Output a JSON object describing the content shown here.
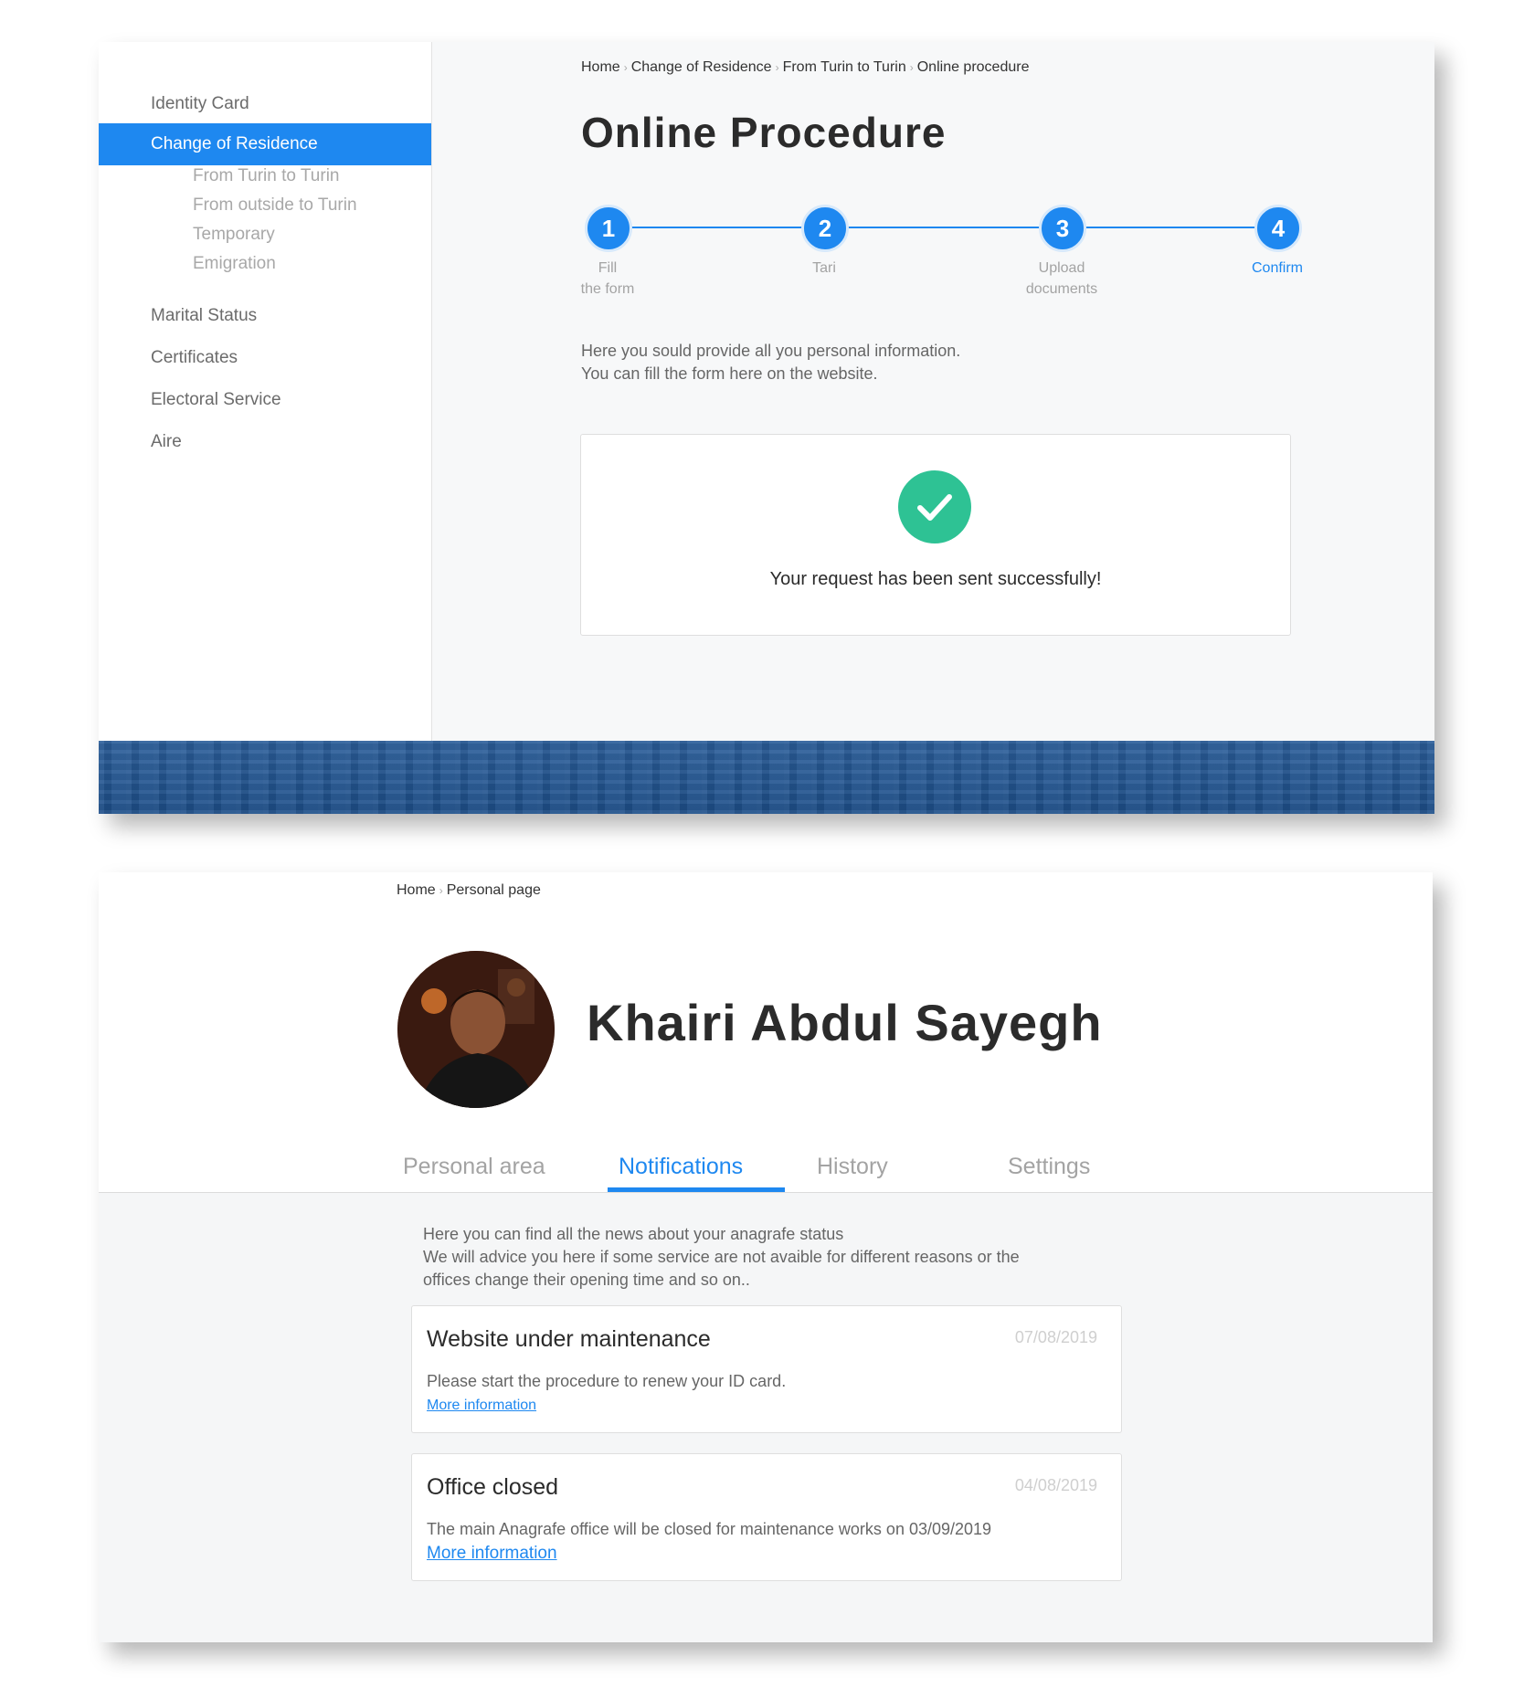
{
  "procedure": {
    "sidebar": {
      "items": [
        "Identity Card",
        "Change of Residence",
        "Marital Status",
        "Certificates",
        "Electoral Service",
        "Aire"
      ],
      "subitems": [
        "From Turin to Turin",
        "From outside to Turin",
        "Temporary",
        "Emigration"
      ]
    },
    "breadcrumb": [
      "Home",
      "Change of Residence",
      "From Turin to Turin",
      "Online procedure"
    ],
    "title": "Online Procedure",
    "steps": [
      {
        "number": "1",
        "label_line1": "Fill",
        "label_line2": "the form"
      },
      {
        "number": "2",
        "label_line1": "Tari",
        "label_line2": ""
      },
      {
        "number": "3",
        "label_line1": "Upload",
        "label_line2": "documents"
      },
      {
        "number": "4",
        "label_line1": "Confirm",
        "label_line2": ""
      }
    ],
    "intro_line1": "Here you sould provide all you personal information.",
    "intro_line2": "You can fill the form here on the website.",
    "success_message": "Your request has been sent successfully!"
  },
  "personal": {
    "breadcrumb": [
      "Home",
      "Personal page"
    ],
    "name": "Khairi Abdul Sayegh",
    "tabs": [
      "Personal area",
      "Notifications",
      "History",
      "Settings"
    ],
    "intro_line1": "Here you can find all the news about your anagrafe status",
    "intro_line2": "We will advice you here if some service are not avaible for different reasons or the",
    "intro_line3": "offices change their opening time and so on..",
    "notifications": [
      {
        "title": "Website under maintenance",
        "date": "07/08/2019",
        "body": "Please start the procedure to renew your ID card.",
        "link": "More information"
      },
      {
        "title": "Office closed",
        "date": "04/08/2019",
        "body": "The main Anagrafe office will be closed for maintenance works on 03/09/2019",
        "link": "More information"
      }
    ]
  },
  "colors": {
    "accent": "#1e88f0",
    "success": "#2ec294",
    "footer": "#24568f"
  }
}
